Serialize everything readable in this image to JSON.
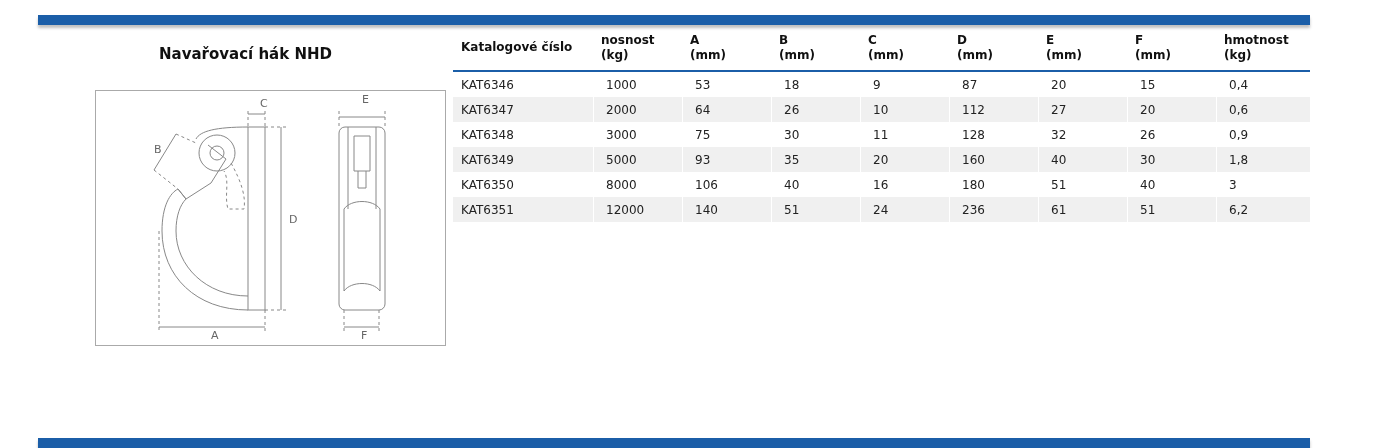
{
  "title": "Navařovací hák NHD",
  "drawing": {
    "labels": [
      {
        "kind": "a",
        "text": "A"
      },
      {
        "kind": "b",
        "text": "B"
      },
      {
        "kind": "c",
        "text": "C"
      },
      {
        "kind": "d",
        "text": "D"
      },
      {
        "kind": "e",
        "text": "E"
      },
      {
        "kind": "f",
        "text": "F"
      }
    ]
  },
  "table": {
    "columns": [
      "Katalogové číslo",
      "nosnost\n(kg)",
      "A\n(mm)",
      "B\n(mm)",
      "C\n(mm)",
      "D\n(mm)",
      "E\n(mm)",
      "F\n(mm)",
      "hmotnost\n(kg)"
    ],
    "rows": [
      [
        "KAT6346",
        "1000",
        "53",
        "18",
        "9",
        "87",
        "20",
        "15",
        "0,4"
      ],
      [
        "KAT6347",
        "2000",
        "64",
        "26",
        "10",
        "112",
        "27",
        "20",
        "0,6"
      ],
      [
        "KAT6348",
        "3000",
        "75",
        "30",
        "11",
        "128",
        "32",
        "26",
        "0,9"
      ],
      [
        "KAT6349",
        "5000",
        "93",
        "35",
        "20",
        "160",
        "40",
        "30",
        "1,8"
      ],
      [
        "KAT6350",
        "8000",
        "106",
        "40",
        "16",
        "180",
        "51",
        "40",
        "3"
      ],
      [
        "KAT6351",
        "12000",
        "140",
        "51",
        "24",
        "236",
        "61",
        "51",
        "6,2"
      ]
    ]
  }
}
